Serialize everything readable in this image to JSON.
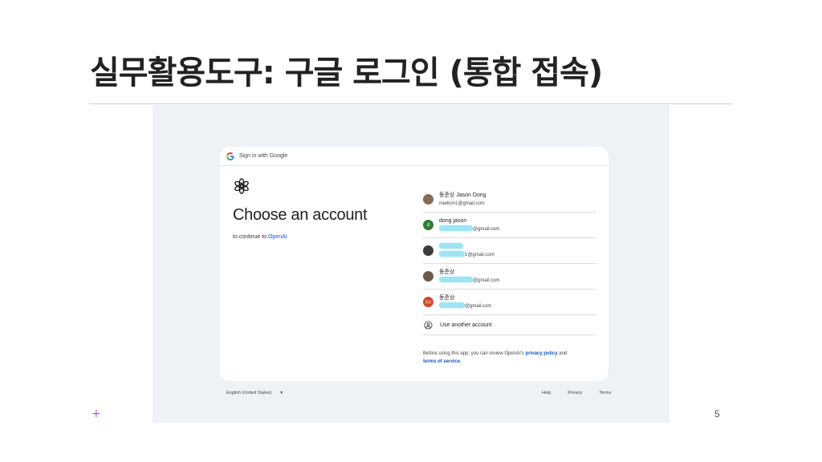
{
  "slide": {
    "title": "실무활용도구: 구글 로그인 (통합 접속)",
    "page_number": "5",
    "plus_mark": "+"
  },
  "signin": {
    "header": "Sign in with Google",
    "heading": "Choose an account",
    "continue_prefix": "to continue to ",
    "app_name": "OpenAI",
    "accounts": [
      {
        "name": "동준상 Jason Dong",
        "email": "naebon1@gmail.com",
        "avatar_color": "#8a6a52"
      },
      {
        "name": "dong jason",
        "email": "@gmail.com",
        "avatar_letter": "d",
        "avatar_color": "#2e7d32"
      },
      {
        "name": "",
        "email": "1@gmail.com",
        "avatar_color": "#3b3b3b"
      },
      {
        "name": "동준상",
        "email": "@gmail.com",
        "avatar_color": "#6d5a4a"
      },
      {
        "name": "동준상",
        "email": "@gmail.com",
        "avatar_letter": "준상",
        "avatar_color": "#d14a2f"
      }
    ],
    "use_another": "Use another account",
    "disclaimer_prefix": "Before using this app, you can review OpenAI's ",
    "privacy_link": "privacy policy",
    "disclaimer_and": " and",
    "terms_link": "terms of service",
    "disclaimer_end": "."
  },
  "footer": {
    "language": "English (United States)",
    "links": [
      "Help",
      "Privacy",
      "Terms"
    ]
  },
  "colors": {
    "link": "#0b57d0",
    "background": "#eef1f6",
    "accent_plus": "#a855f7"
  }
}
